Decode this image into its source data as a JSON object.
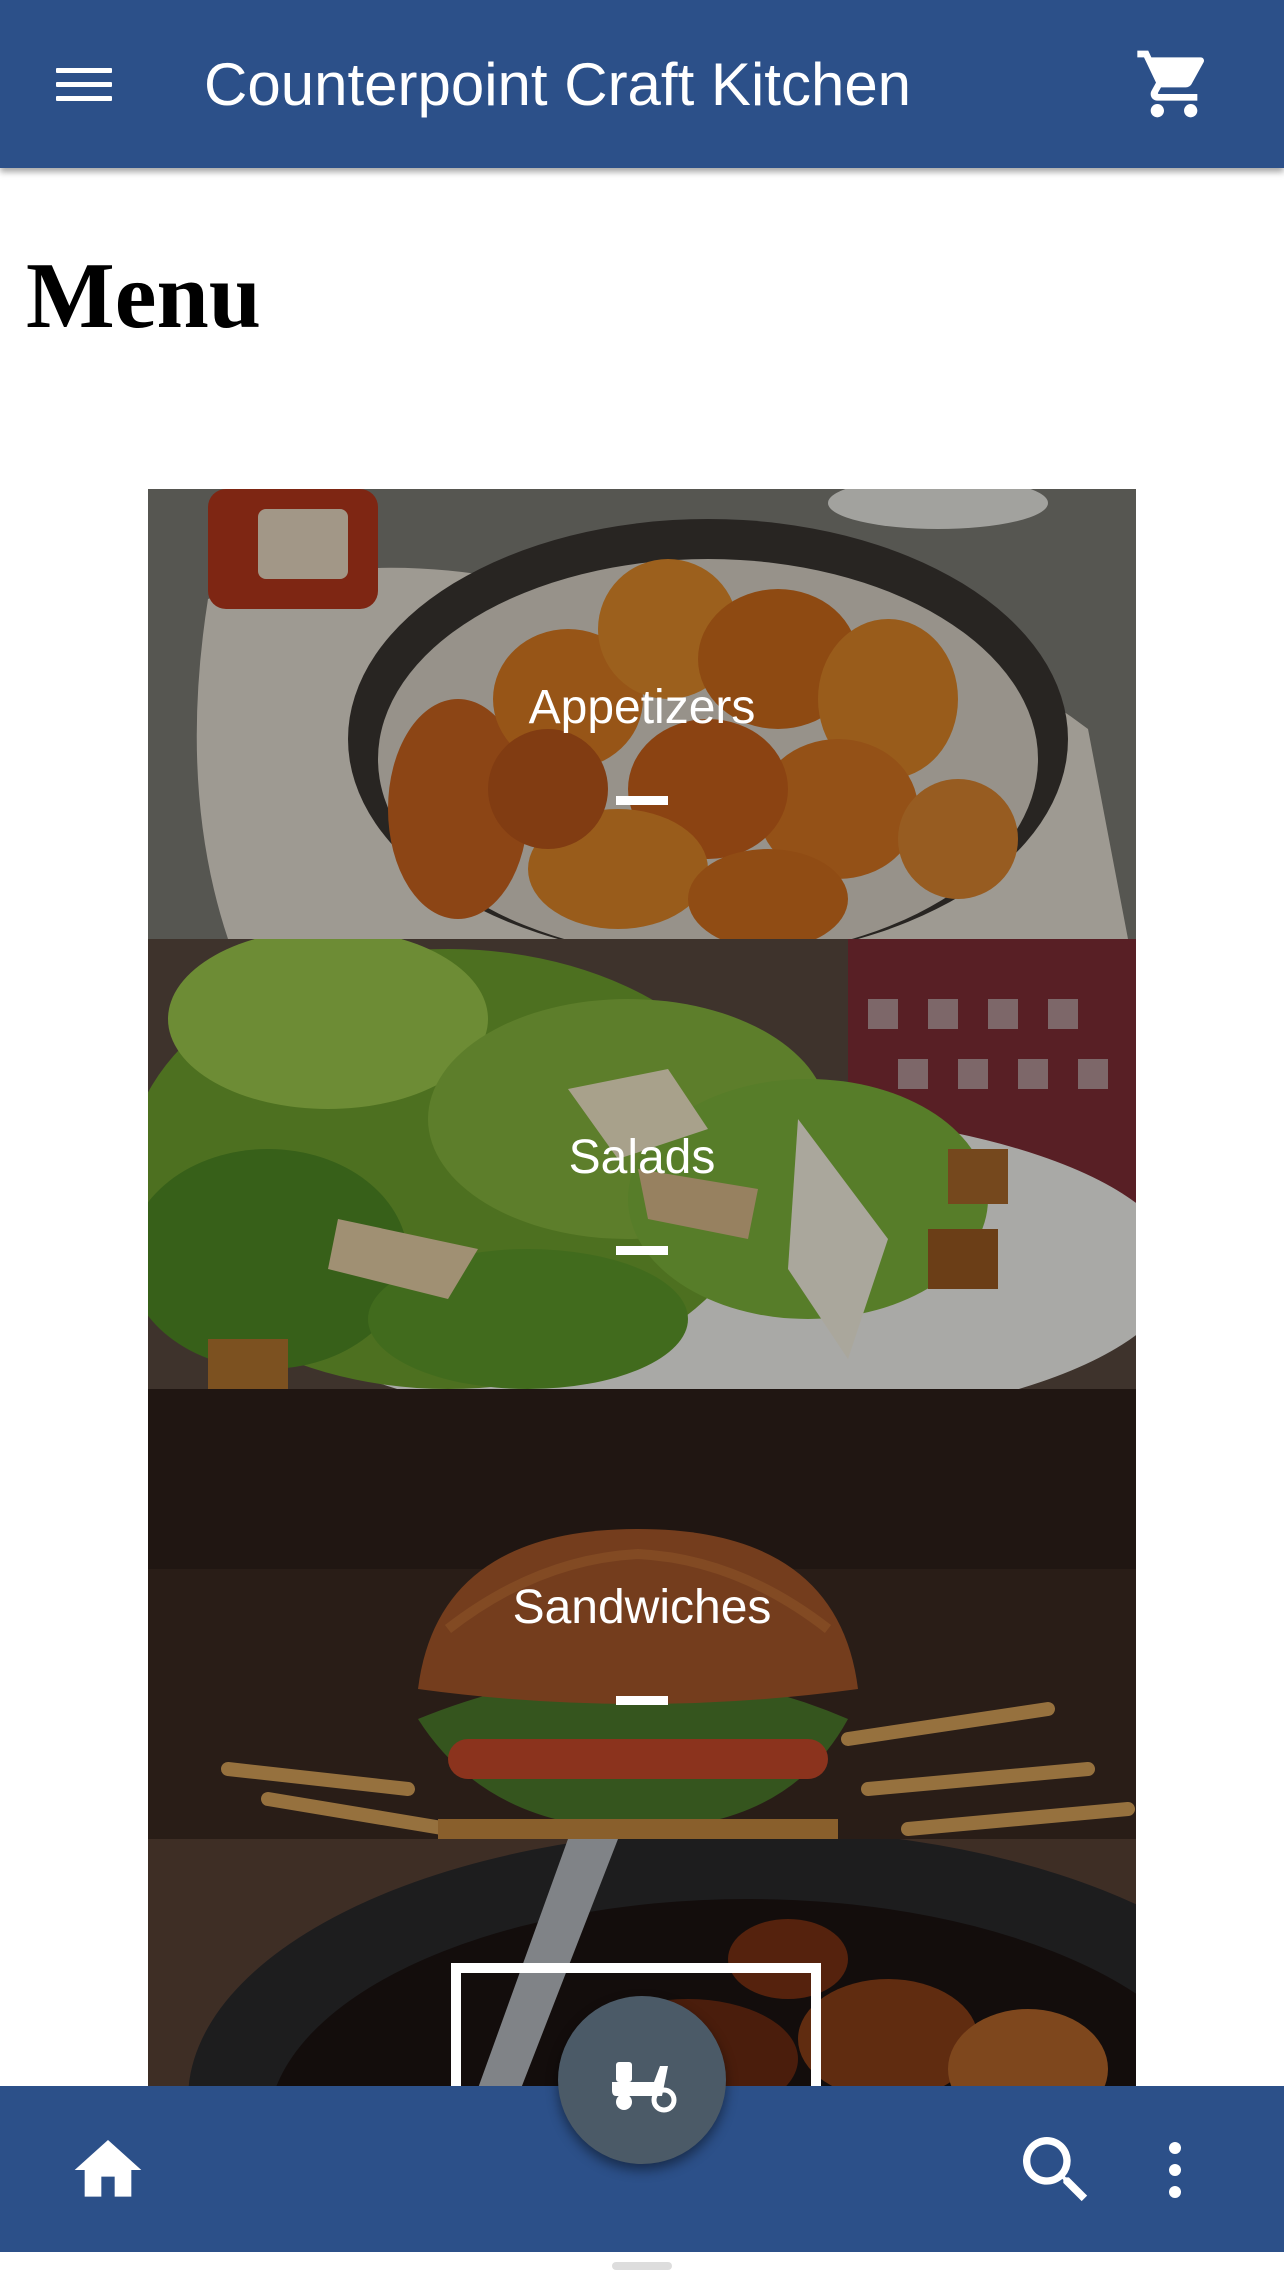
{
  "app": {
    "title": "Counterpoint Craft Kitchen",
    "brand_color": "#2c5089"
  },
  "header": {
    "menu_icon": "hamburger-menu-icon",
    "cart_icon": "shopping-cart-icon"
  },
  "page": {
    "heading": "Menu"
  },
  "categories": [
    {
      "label": "Appetizers",
      "image": "buffalo-wings-photo"
    },
    {
      "label": "Salads",
      "image": "caesar-salad-photo"
    },
    {
      "label": "Sandwiches",
      "image": "burger-and-fries-photo"
    },
    {
      "label": "",
      "image": "braised-meat-skillet-photo"
    }
  ],
  "bottom_nav": {
    "home_icon": "home-icon",
    "search_icon": "search-icon",
    "more_icon": "more-vertical-icon",
    "fab_icon": "delivery-scooter-icon",
    "fab_color": "#4b5a67"
  }
}
